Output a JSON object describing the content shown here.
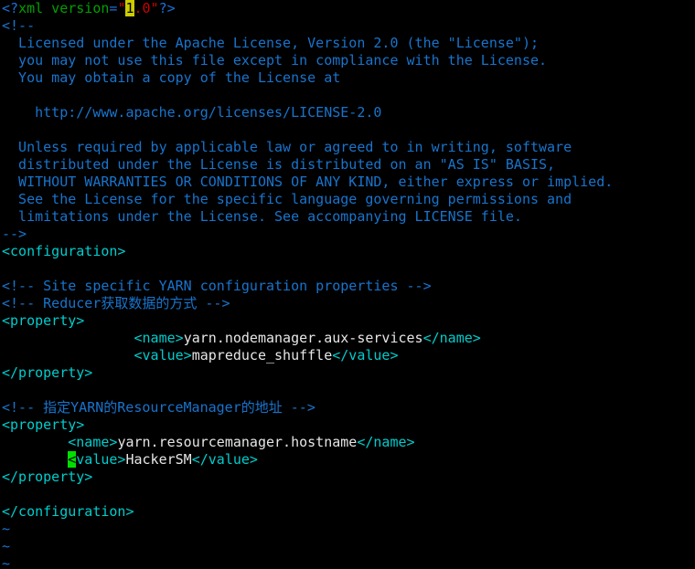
{
  "app": {
    "kind": "terminal-text-editor",
    "editor": "vim",
    "background_color": "#000000",
    "font_kind": "monospace"
  },
  "colors": {
    "comment_blue": "#1874cd",
    "tag_cyan": "#00cdcd",
    "content_white": "#e6e6e6",
    "attr_green": "#00a000",
    "punct_blue": "#1c70d8",
    "string_red": "#cd0000",
    "cursor_gold_bg": "#cdcd00",
    "cursor_green_bg": "#00e000",
    "tilde_blue": "#1874cd"
  },
  "document": {
    "language": "xml",
    "lines": [
      {
        "n": 1,
        "segments": [
          {
            "text": "<?",
            "cls": "c-punct"
          },
          {
            "text": "xml version",
            "cls": "c-attr"
          },
          {
            "text": "=",
            "cls": "c-punct"
          },
          {
            "text": "\"",
            "cls": "c-str"
          },
          {
            "text": "1",
            "cls": "cursor-gold"
          },
          {
            "text": ".0\"",
            "cls": "c-str"
          },
          {
            "text": "?>",
            "cls": "c-punct"
          }
        ]
      },
      {
        "n": 2,
        "segments": [
          {
            "text": "<!--",
            "cls": "c-comment"
          }
        ]
      },
      {
        "n": 3,
        "segments": [
          {
            "text": "  Licensed under the Apache License, Version 2.0 (the \"License\");",
            "cls": "c-comment"
          }
        ]
      },
      {
        "n": 4,
        "segments": [
          {
            "text": "  you may not use this file except in compliance with the License.",
            "cls": "c-comment"
          }
        ]
      },
      {
        "n": 5,
        "segments": [
          {
            "text": "  You may obtain a copy of the License at",
            "cls": "c-comment"
          }
        ]
      },
      {
        "n": 6,
        "segments": [
          {
            "text": "",
            "cls": "c-comment"
          }
        ]
      },
      {
        "n": 7,
        "segments": [
          {
            "text": "    http://www.apache.org/licenses/LICENSE-2.0",
            "cls": "c-comment"
          }
        ]
      },
      {
        "n": 8,
        "segments": [
          {
            "text": "",
            "cls": "c-comment"
          }
        ]
      },
      {
        "n": 9,
        "segments": [
          {
            "text": "  Unless required by applicable law or agreed to in writing, software",
            "cls": "c-comment"
          }
        ]
      },
      {
        "n": 10,
        "segments": [
          {
            "text": "  distributed under the License is distributed on an \"AS IS\" BASIS,",
            "cls": "c-comment"
          }
        ]
      },
      {
        "n": 11,
        "segments": [
          {
            "text": "  WITHOUT WARRANTIES OR CONDITIONS OF ANY KIND, either express or implied.",
            "cls": "c-comment"
          }
        ]
      },
      {
        "n": 12,
        "segments": [
          {
            "text": "  See the License for the specific language governing permissions and",
            "cls": "c-comment"
          }
        ]
      },
      {
        "n": 13,
        "segments": [
          {
            "text": "  limitations under the License. See accompanying LICENSE file.",
            "cls": "c-comment"
          }
        ]
      },
      {
        "n": 14,
        "segments": [
          {
            "text": "-->",
            "cls": "c-comment"
          }
        ]
      },
      {
        "n": 15,
        "segments": [
          {
            "text": "<configuration>",
            "cls": "c-tag"
          }
        ]
      },
      {
        "n": 16,
        "segments": [
          {
            "text": "",
            "cls": "c-text"
          }
        ]
      },
      {
        "n": 17,
        "segments": [
          {
            "text": "<!-- Site specific YARN configuration properties -->",
            "cls": "c-comment"
          }
        ]
      },
      {
        "n": 18,
        "segments": [
          {
            "text": "<!-- Reducer获取数据的方式 -->",
            "cls": "c-comment"
          }
        ]
      },
      {
        "n": 19,
        "segments": [
          {
            "text": "<property>",
            "cls": "c-tag"
          }
        ]
      },
      {
        "n": 20,
        "segments": [
          {
            "text": "                <name>",
            "cls": "c-tag"
          },
          {
            "text": "yarn.nodemanager.aux-services",
            "cls": "c-text"
          },
          {
            "text": "</name>",
            "cls": "c-tag"
          }
        ]
      },
      {
        "n": 21,
        "segments": [
          {
            "text": "                <value>",
            "cls": "c-tag"
          },
          {
            "text": "mapreduce_shuffle",
            "cls": "c-text"
          },
          {
            "text": "</value>",
            "cls": "c-tag"
          }
        ]
      },
      {
        "n": 22,
        "segments": [
          {
            "text": "</property>",
            "cls": "c-tag"
          }
        ]
      },
      {
        "n": 23,
        "segments": [
          {
            "text": "",
            "cls": "c-text"
          }
        ]
      },
      {
        "n": 24,
        "segments": [
          {
            "text": "<!-- 指定YARN的ResourceManager的地址 -->",
            "cls": "c-comment"
          }
        ]
      },
      {
        "n": 25,
        "segments": [
          {
            "text": "<property>",
            "cls": "c-tag"
          }
        ]
      },
      {
        "n": 26,
        "segments": [
          {
            "text": "        <name>",
            "cls": "c-tag"
          },
          {
            "text": "yarn.resourcemanager.hostname",
            "cls": "c-text"
          },
          {
            "text": "</name>",
            "cls": "c-tag"
          }
        ]
      },
      {
        "n": 27,
        "segments": [
          {
            "text": "        ",
            "cls": "c-tag"
          },
          {
            "text": "<",
            "cls": "cursor-green"
          },
          {
            "text": "value>",
            "cls": "c-tag"
          },
          {
            "text": "HackerSM",
            "cls": "c-text"
          },
          {
            "text": "</value>",
            "cls": "c-tag"
          }
        ]
      },
      {
        "n": 28,
        "segments": [
          {
            "text": "</property>",
            "cls": "c-tag"
          }
        ]
      },
      {
        "n": 29,
        "segments": [
          {
            "text": "",
            "cls": "c-text"
          }
        ]
      },
      {
        "n": 30,
        "segments": [
          {
            "text": "</configuration>",
            "cls": "c-tag"
          }
        ]
      },
      {
        "n": 31,
        "segments": [
          {
            "text": "~",
            "cls": "c-tilde"
          }
        ]
      },
      {
        "n": 32,
        "segments": [
          {
            "text": "~",
            "cls": "c-tilde"
          }
        ]
      },
      {
        "n": 33,
        "segments": [
          {
            "text": "~",
            "cls": "c-tilde"
          }
        ]
      }
    ]
  },
  "cursor": {
    "line": 27,
    "column": 9,
    "character": "<",
    "style": "block",
    "color": "#00e000"
  }
}
